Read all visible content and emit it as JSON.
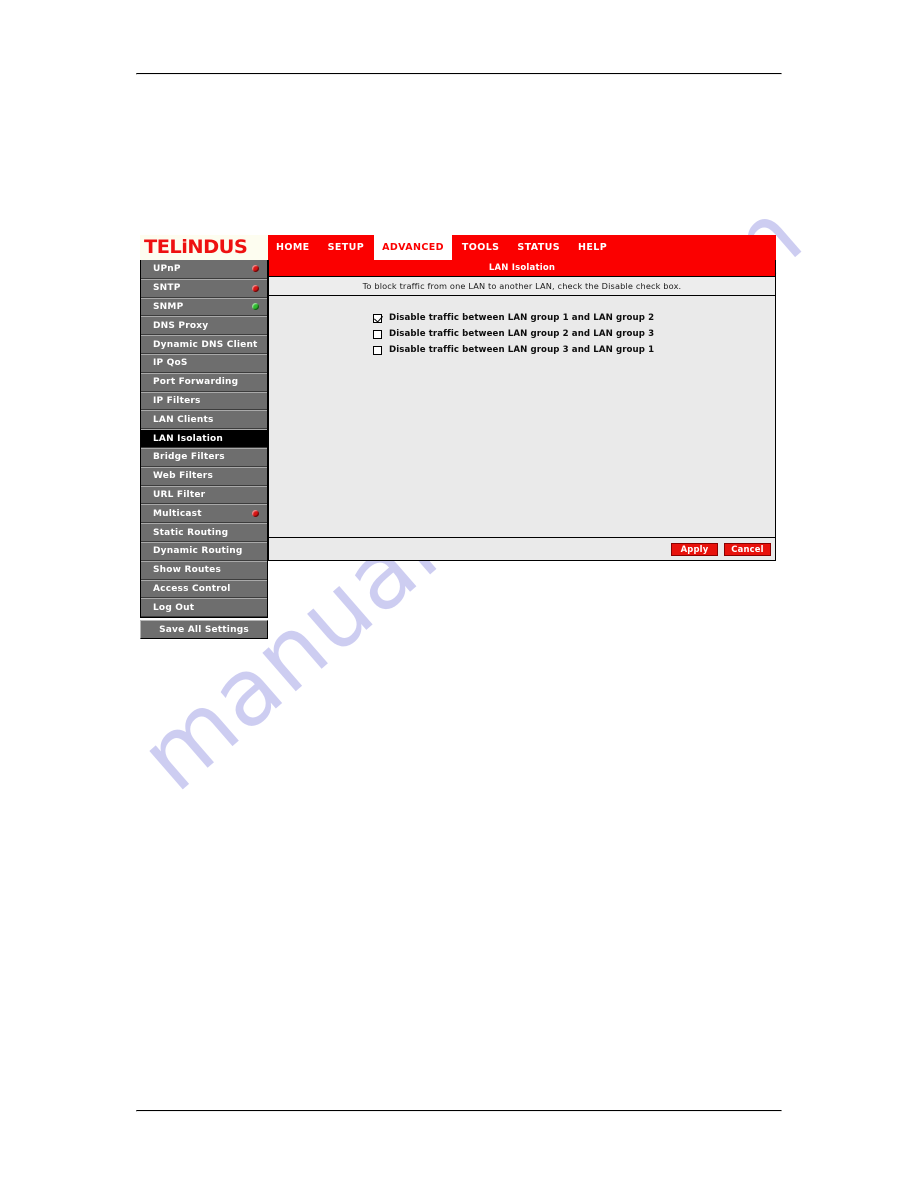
{
  "document": {
    "watermark": "manualshive.com"
  },
  "router_ui": {
    "brand": "TELiNDUS",
    "nav_tabs": [
      {
        "label": "HOME",
        "active": false
      },
      {
        "label": "SETUP",
        "active": false
      },
      {
        "label": "ADVANCED",
        "active": true
      },
      {
        "label": "TOOLS",
        "active": false
      },
      {
        "label": "STATUS",
        "active": false
      },
      {
        "label": "HELP",
        "active": false
      }
    ],
    "sidebar": {
      "items": [
        {
          "label": "UPnP",
          "led": "red",
          "active": false
        },
        {
          "label": "SNTP",
          "led": "red",
          "active": false
        },
        {
          "label": "SNMP",
          "led": "green",
          "active": false
        },
        {
          "label": "DNS Proxy",
          "led": "none",
          "active": false
        },
        {
          "label": "Dynamic DNS Client",
          "led": "none",
          "active": false
        },
        {
          "label": "IP QoS",
          "led": "none",
          "active": false
        },
        {
          "label": "Port Forwarding",
          "led": "none",
          "active": false
        },
        {
          "label": "IP Filters",
          "led": "none",
          "active": false
        },
        {
          "label": "LAN Clients",
          "led": "none",
          "active": false
        },
        {
          "label": "LAN Isolation",
          "led": "none",
          "active": true
        },
        {
          "label": "Bridge Filters",
          "led": "none",
          "active": false
        },
        {
          "label": "Web Filters",
          "led": "none",
          "active": false
        },
        {
          "label": "URL Filter",
          "led": "none",
          "active": false
        },
        {
          "label": "Multicast",
          "led": "red",
          "active": false
        },
        {
          "label": "Static Routing",
          "led": "none",
          "active": false
        },
        {
          "label": "Dynamic Routing",
          "led": "none",
          "active": false
        },
        {
          "label": "Show Routes",
          "led": "none",
          "active": false
        },
        {
          "label": "Access Control",
          "led": "none",
          "active": false
        },
        {
          "label": "Log Out",
          "led": "none",
          "active": false
        }
      ],
      "save_all_label": "Save All Settings"
    },
    "content": {
      "title": "LAN Isolation",
      "hint": "To block traffic from one LAN to another LAN, check the Disable check box.",
      "checkboxes": [
        {
          "label": "Disable traffic between LAN group 1 and LAN group 2",
          "checked": true
        },
        {
          "label": "Disable traffic between LAN group 2 and LAN group 3",
          "checked": false
        },
        {
          "label": "Disable traffic between LAN group 3 and LAN group 1",
          "checked": false
        }
      ],
      "apply_label": "Apply",
      "cancel_label": "Cancel"
    },
    "colors": {
      "brand_red": "#fb0000",
      "button_red": "#e8120c",
      "menu_gray": "#6e6e6e",
      "panel_gray": "#eaeaea",
      "led_red": "#d81414",
      "led_green": "#2fbd2f"
    }
  }
}
